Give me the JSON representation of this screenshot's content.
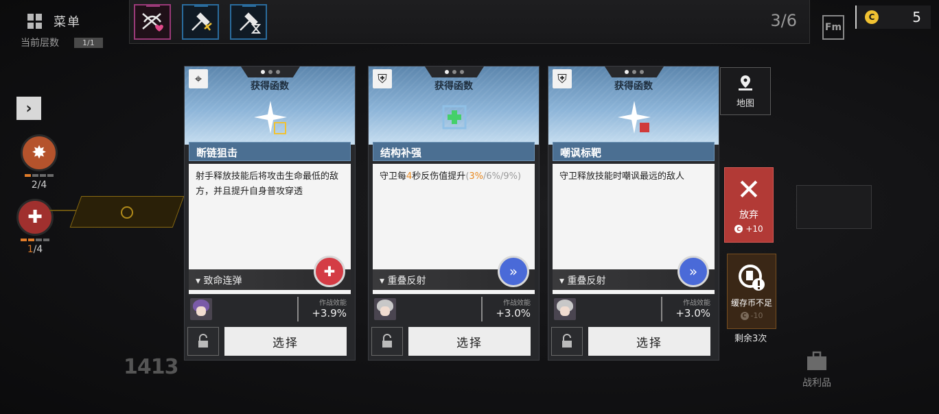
{
  "menu": {
    "label": "菜单",
    "floor_label": "当前层数",
    "floor_value": "1/1"
  },
  "topbar": {
    "tools": [
      {
        "icon": "heart-crossbow-icon",
        "color": "#9a3a78"
      },
      {
        "icon": "hammer-wrench-icon",
        "color": "#2a6c9e"
      },
      {
        "icon": "hammer-hourglass-icon",
        "color": "#2a6c9e"
      }
    ],
    "counter": "3/6"
  },
  "currency": {
    "symbol": "C",
    "amount": "5"
  },
  "resources": [
    {
      "icon": "burst-shield-icon",
      "bar": 4,
      "filled": 1,
      "count_current": "2",
      "count_total": "/4",
      "color": "#b5532c"
    },
    {
      "icon": "bandage-icon",
      "bar": 4,
      "filled": 2,
      "count_current": "1",
      "count_total": "/4",
      "color": "#a0302e"
    }
  ],
  "floor_number": "1413",
  "cards": [
    {
      "badge": "⌖",
      "kicker": "获得函数",
      "name": "断链狙击",
      "desc_parts": [
        {
          "t": "射手释放技能后将攻击生命最低的敌方，并且提升自身普攻穿透",
          "c": ""
        }
      ],
      "tag": "致命连弹",
      "tag_color": "red",
      "tag_glyph": "✚",
      "operator": {
        "hair": "#7a5aa8"
      },
      "eff_label": "作战效能",
      "eff_value": "+3.9%",
      "select": "选择",
      "art_accent": "#f1c232"
    },
    {
      "badge": "⛨",
      "kicker": "获得函数",
      "name": "结构补强",
      "desc_parts": [
        {
          "t": "守卫每",
          "c": ""
        },
        {
          "t": "4",
          "c": "orange"
        },
        {
          "t": "秒反伤值提升",
          "c": ""
        },
        {
          "t": "(",
          "c": "gray"
        },
        {
          "t": "3%",
          "c": "orange"
        },
        {
          "t": "/6%/9%)",
          "c": "gray"
        }
      ],
      "tag": "重叠反射",
      "tag_color": "blue",
      "tag_glyph": "»",
      "operator": {
        "hair": "#c8c8c8"
      },
      "eff_label": "作战效能",
      "eff_value": "+3.0%",
      "select": "选择",
      "art_accent": "#45d06a"
    },
    {
      "badge": "⛨",
      "kicker": "获得函数",
      "name": "嘲讽标靶",
      "desc_parts": [
        {
          "t": "守卫释放技能时嘲讽最远的敌人",
          "c": ""
        }
      ],
      "tag": "重叠反射",
      "tag_color": "blue",
      "tag_glyph": "»",
      "operator": {
        "hair": "#c8c8c8"
      },
      "eff_label": "作战效能",
      "eff_value": "+3.0%",
      "select": "选择",
      "art_accent": "#d03a3a"
    }
  ],
  "map_button": {
    "label": "地图"
  },
  "abandon": {
    "label": "放弃",
    "reward": "+10"
  },
  "cache": {
    "label": "缓存币不足",
    "cost": "-10",
    "remaining": "剩余3次"
  },
  "loot": {
    "label": "战利品"
  }
}
